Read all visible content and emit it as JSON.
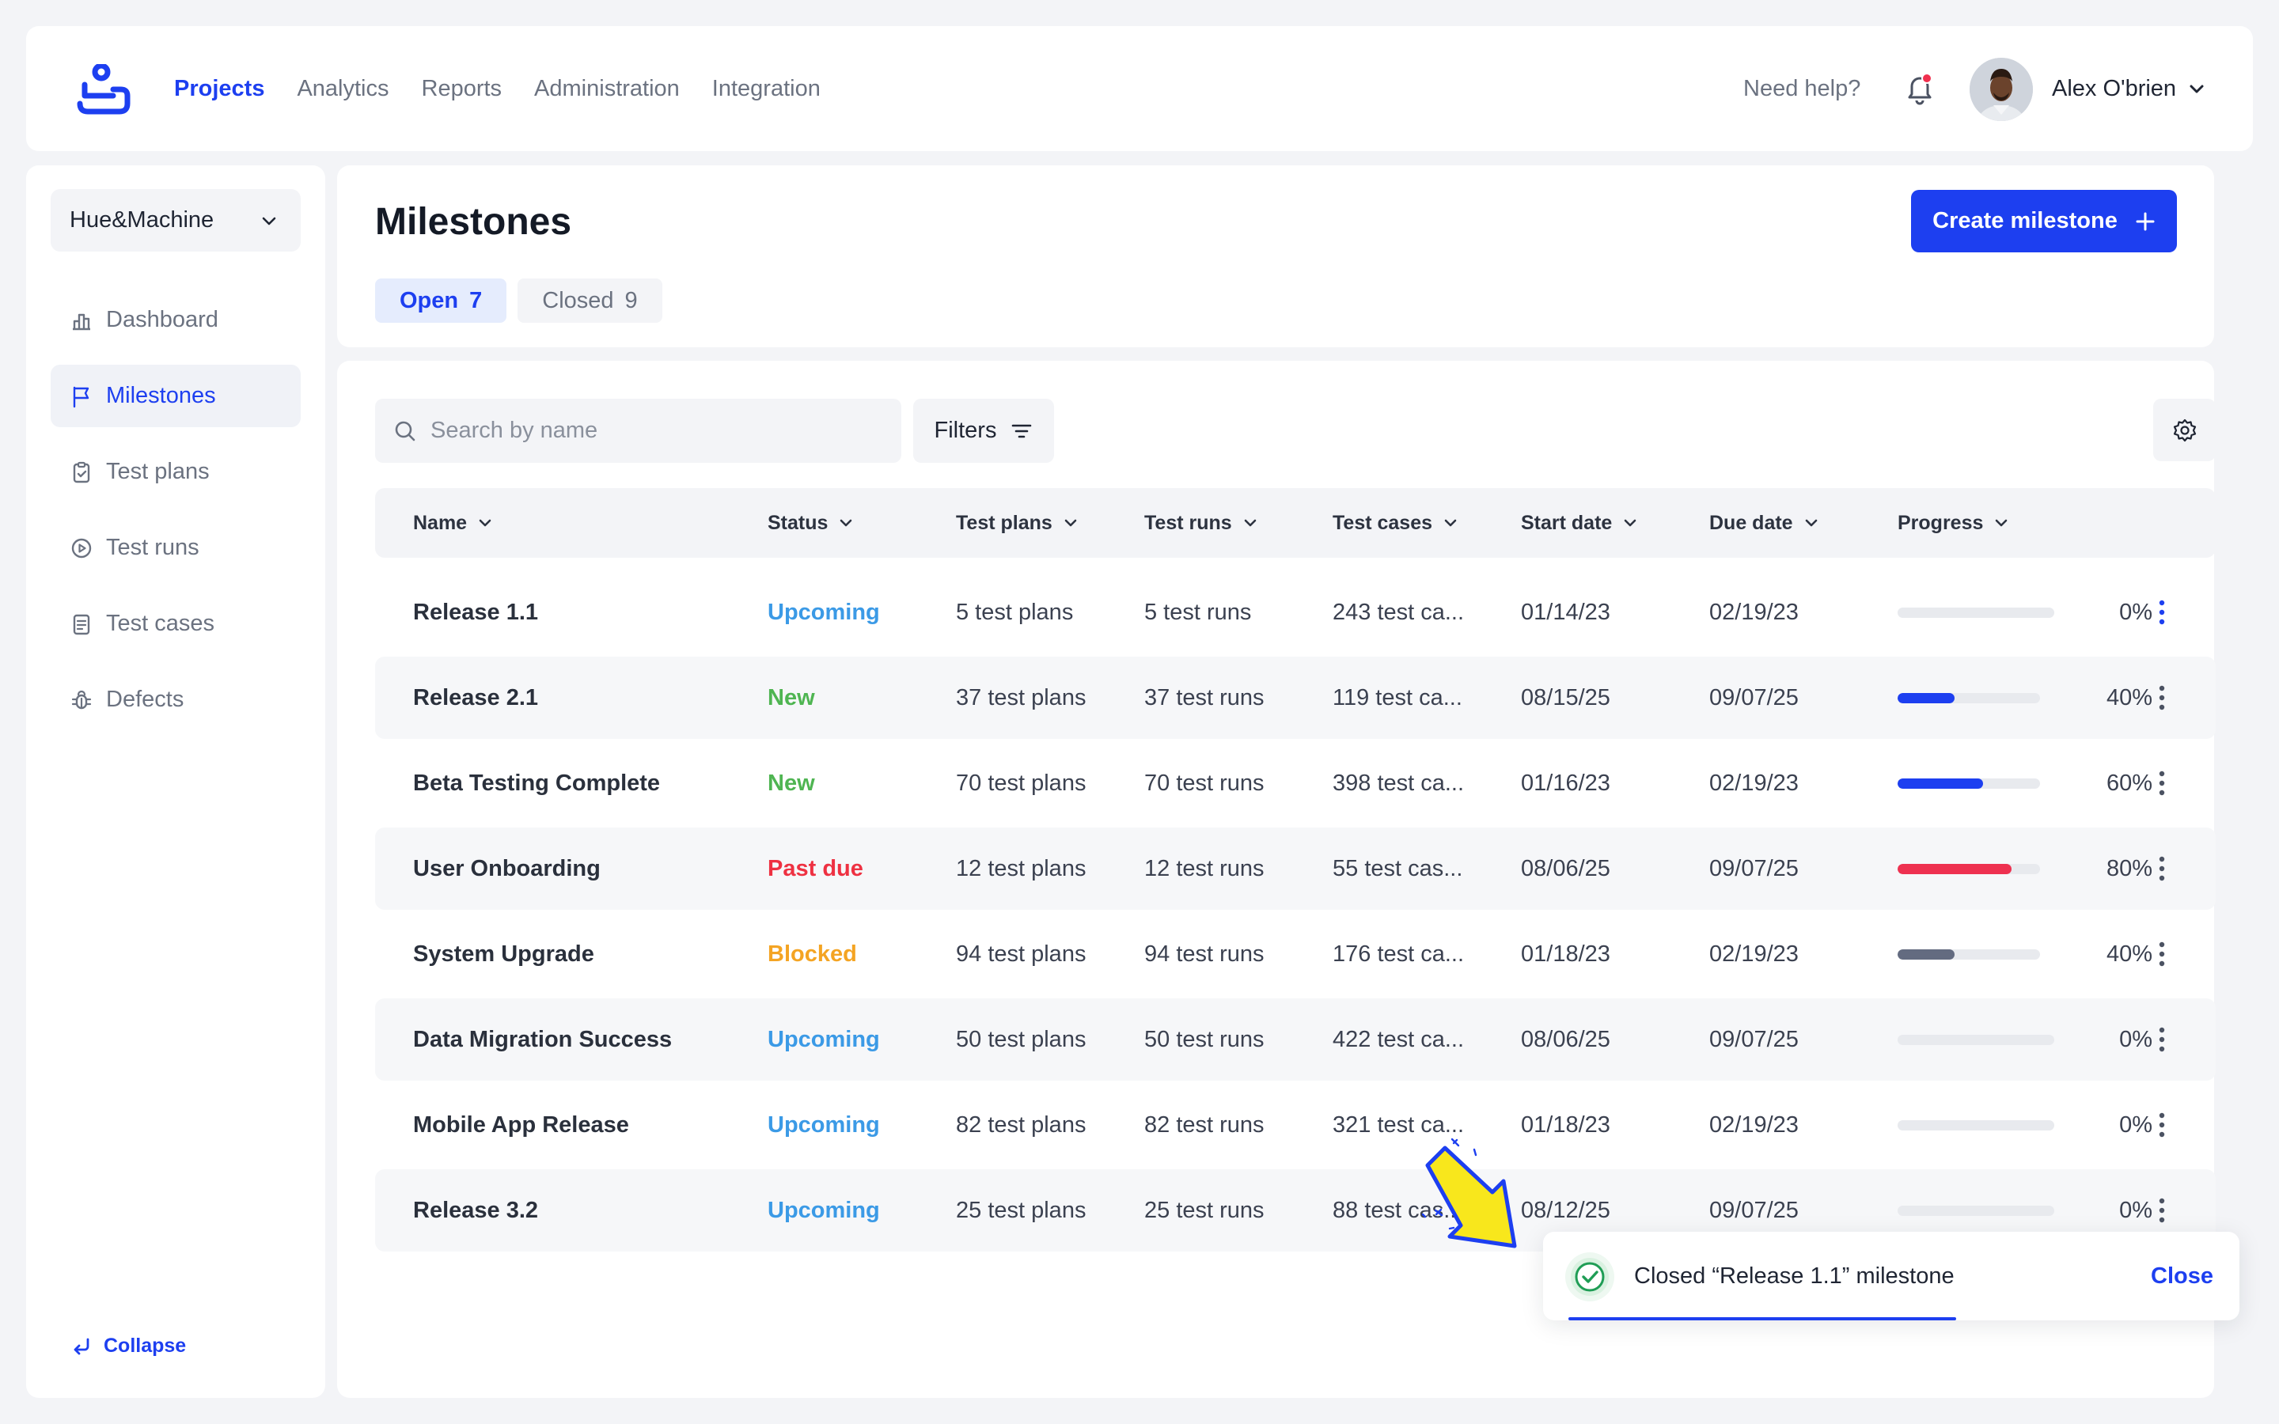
{
  "topnav": {
    "links": [
      {
        "label": "Projects",
        "active": true
      },
      {
        "label": "Analytics",
        "active": false
      },
      {
        "label": "Reports",
        "active": false
      },
      {
        "label": "Administration",
        "active": false
      },
      {
        "label": "Integration",
        "active": false
      }
    ],
    "help_label": "Need help?",
    "user_name": "Alex O'brien",
    "notification_dot_color": "#f0304e"
  },
  "sidebar": {
    "project": "Hue&Machine",
    "items": [
      {
        "label": "Dashboard",
        "icon": "dashboard-icon",
        "active": false
      },
      {
        "label": "Milestones",
        "icon": "flag-icon",
        "active": true
      },
      {
        "label": "Test plans",
        "icon": "clipboard-icon",
        "active": false
      },
      {
        "label": "Test runs",
        "icon": "play-circle-icon",
        "active": false
      },
      {
        "label": "Test cases",
        "icon": "document-icon",
        "active": false
      },
      {
        "label": "Defects",
        "icon": "bug-icon",
        "active": false
      }
    ],
    "collapse_label": "Collapse"
  },
  "header": {
    "title": "Milestones",
    "tabs": [
      {
        "label": "Open",
        "count": "7",
        "active": true
      },
      {
        "label": "Closed",
        "count": "9",
        "active": false
      }
    ],
    "create_label": "Create milestone"
  },
  "toolbar": {
    "search_placeholder": "Search by name",
    "filters_label": "Filters"
  },
  "table": {
    "columns": [
      "Name",
      "Status",
      "Test plans",
      "Test runs",
      "Test cases",
      "Start date",
      "Due date",
      "Progress"
    ],
    "rows": [
      {
        "name": "Release 1.1",
        "status": "Upcoming",
        "plans": "5 test plans",
        "runs": "5 test runs",
        "cases": "243 test ca...",
        "start": "01/14/23",
        "due": "02/19/23",
        "progress": 0,
        "progress_label": "0%"
      },
      {
        "name": "Release 2.1",
        "status": "New",
        "plans": "37 test plans",
        "runs": "37 test runs",
        "cases": "119 test ca...",
        "start": "08/15/25",
        "due": "09/07/25",
        "progress": 40,
        "progress_label": "40%"
      },
      {
        "name": "Beta Testing Complete",
        "status": "New",
        "plans": "70 test plans",
        "runs": "70 test runs",
        "cases": "398 test ca...",
        "start": "01/16/23",
        "due": "02/19/23",
        "progress": 60,
        "progress_label": "60%"
      },
      {
        "name": "User Onboarding",
        "status": "Past due",
        "plans": "12 test plans",
        "runs": "12 test runs",
        "cases": "55 test cas...",
        "start": "08/06/25",
        "due": "09/07/25",
        "progress": 80,
        "progress_label": "80%"
      },
      {
        "name": "System Upgrade",
        "status": "Blocked",
        "plans": "94 test plans",
        "runs": "94 test runs",
        "cases": "176 test ca...",
        "start": "01/18/23",
        "due": "02/19/23",
        "progress": 40,
        "progress_label": "40%"
      },
      {
        "name": "Data Migration Success",
        "status": "Upcoming",
        "plans": "50 test plans",
        "runs": "50 test runs",
        "cases": "422 test ca...",
        "start": "08/06/25",
        "due": "09/07/25",
        "progress": 0,
        "progress_label": "0%"
      },
      {
        "name": "Mobile App Release",
        "status": "Upcoming",
        "plans": "82 test plans",
        "runs": "82 test runs",
        "cases": "321 test ca...",
        "start": "01/18/23",
        "due": "02/19/23",
        "progress": 0,
        "progress_label": "0%"
      },
      {
        "name": "Release 3.2",
        "status": "Upcoming",
        "plans": "25 test plans",
        "runs": "25 test runs",
        "cases": "88 test cas...",
        "start": "08/12/25",
        "due": "09/07/25",
        "progress": 0,
        "progress_label": "0%"
      }
    ]
  },
  "status_colors": {
    "Upcoming": "#3b9ae6",
    "New": "#4fb552",
    "Past due": "#ee3142",
    "Blocked": "#f4a423"
  },
  "progress_colors": {
    "New": "#1d3ff0",
    "Past due": "#ee3150",
    "Blocked": "#636b80",
    "Upcoming": "#1d3ff0"
  },
  "toast": {
    "message": "Closed “Release 1.1” milestone",
    "close_label": "Close"
  },
  "colors": {
    "accent": "#1d3ff0",
    "background": "#f3f4f7"
  }
}
